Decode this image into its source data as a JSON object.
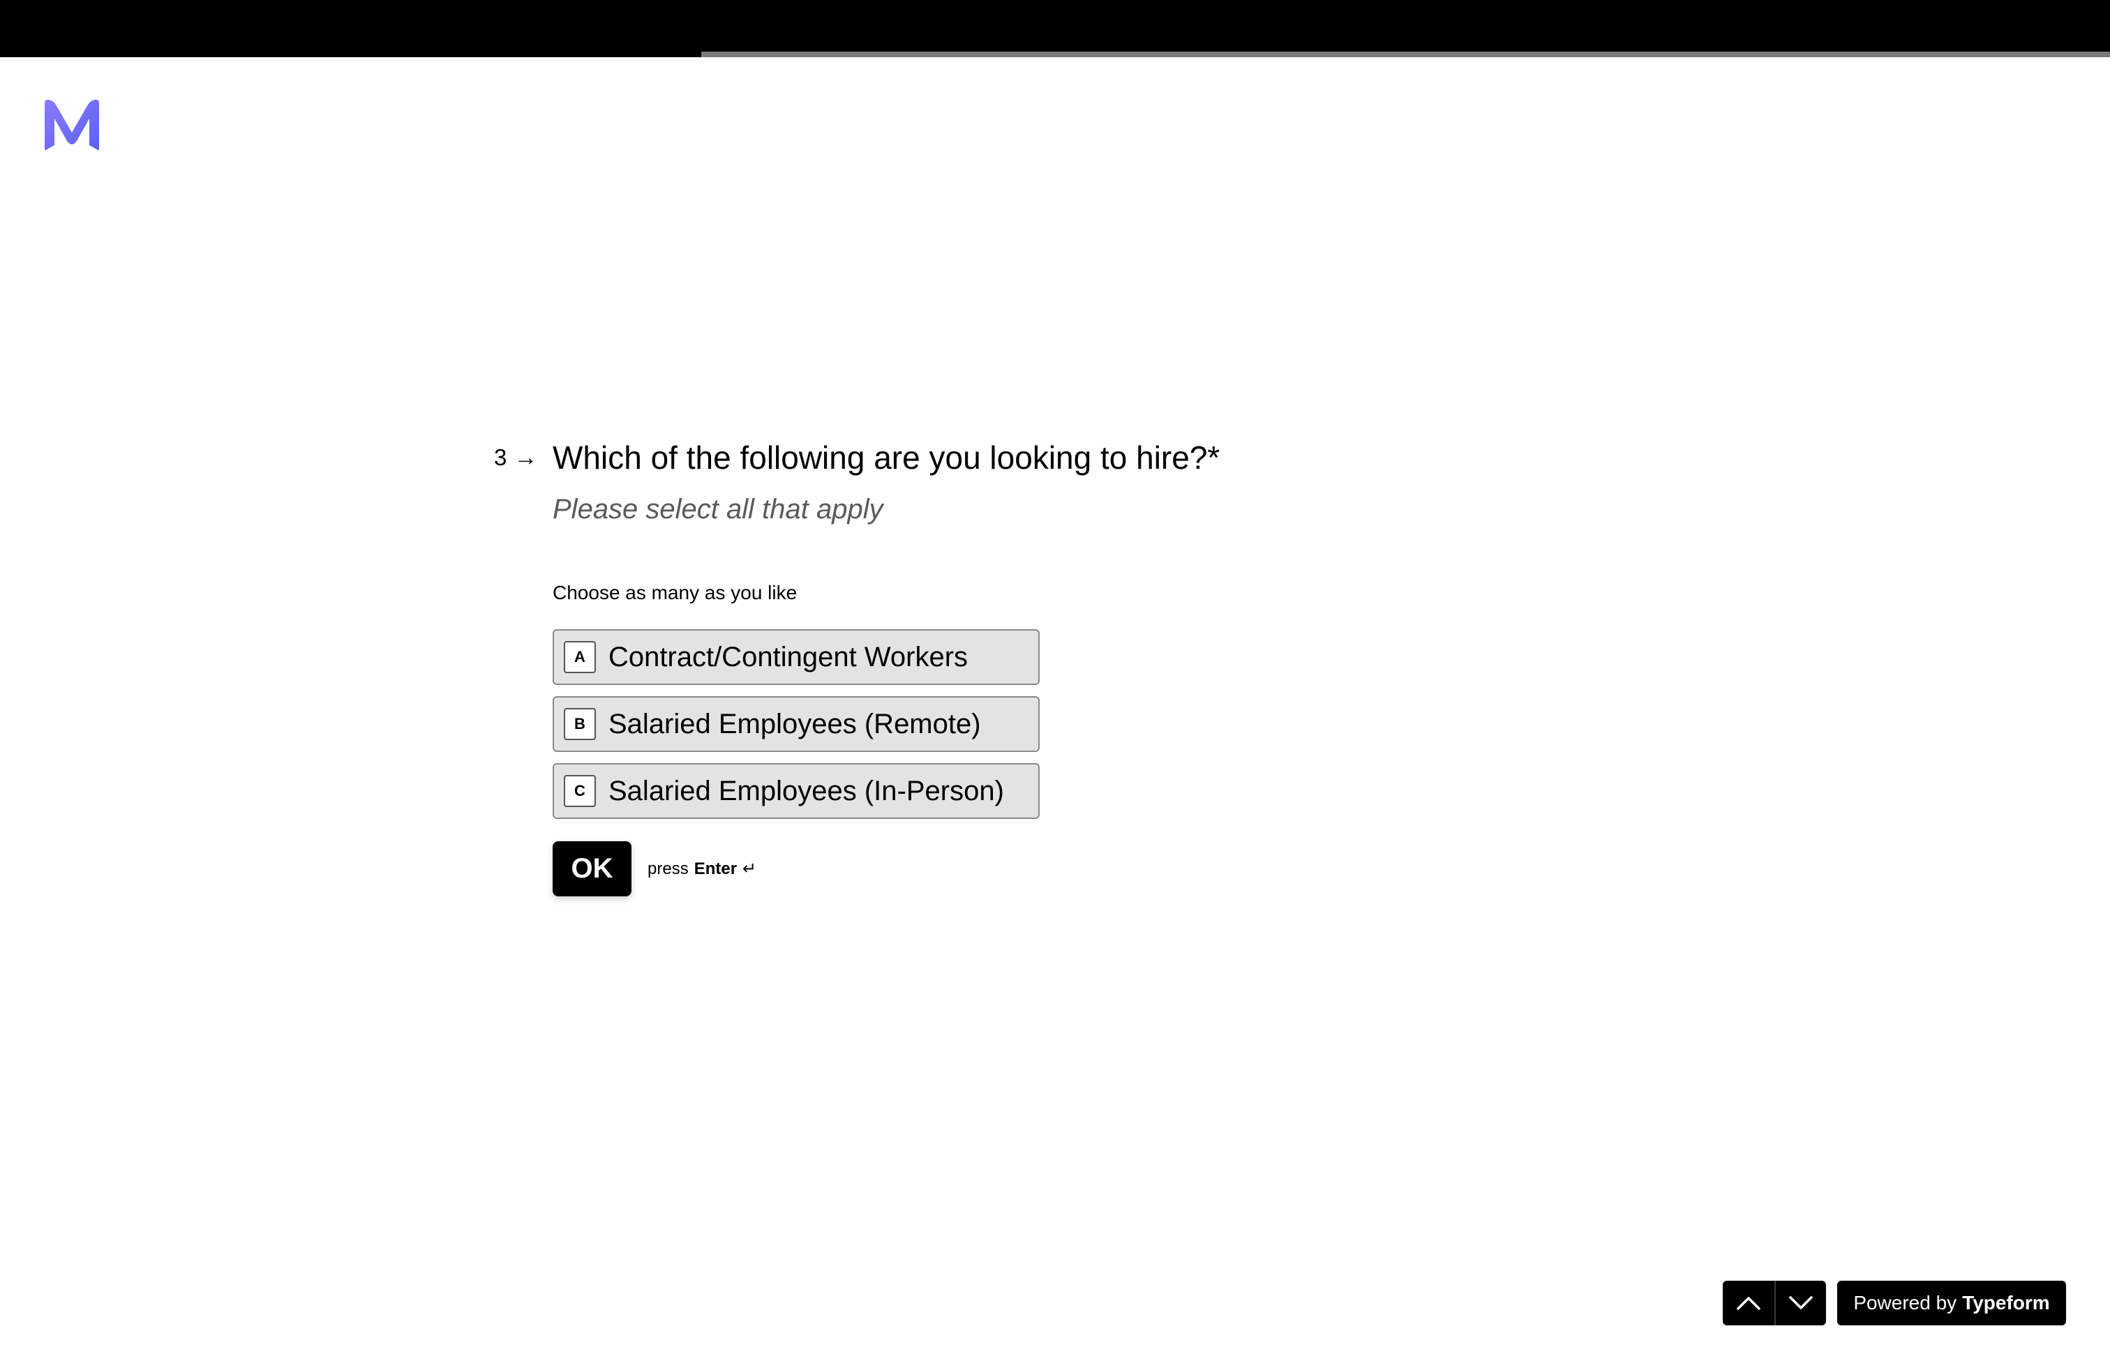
{
  "progress": {
    "fraction": 0.33
  },
  "brand": {
    "logo_icon": "m-logo-icon",
    "logo_color": "#6c63ff"
  },
  "question": {
    "number": "3",
    "title": "Which of the following are you looking to hire?*",
    "subtitle": "Please select all that apply",
    "instruction": "Choose as many as you like"
  },
  "choices": [
    {
      "key": "A",
      "label": "Contract/Contingent Workers"
    },
    {
      "key": "B",
      "label": "Salaried Employees (Remote)"
    },
    {
      "key": "C",
      "label": "Salaried Employees (In-Person)"
    }
  ],
  "actions": {
    "ok_label": "OK",
    "press_text": "press",
    "enter_text": "Enter",
    "enter_symbol": "↵"
  },
  "footer": {
    "powered_by_prefix": "Powered by",
    "powered_by_brand": "Typeform"
  }
}
